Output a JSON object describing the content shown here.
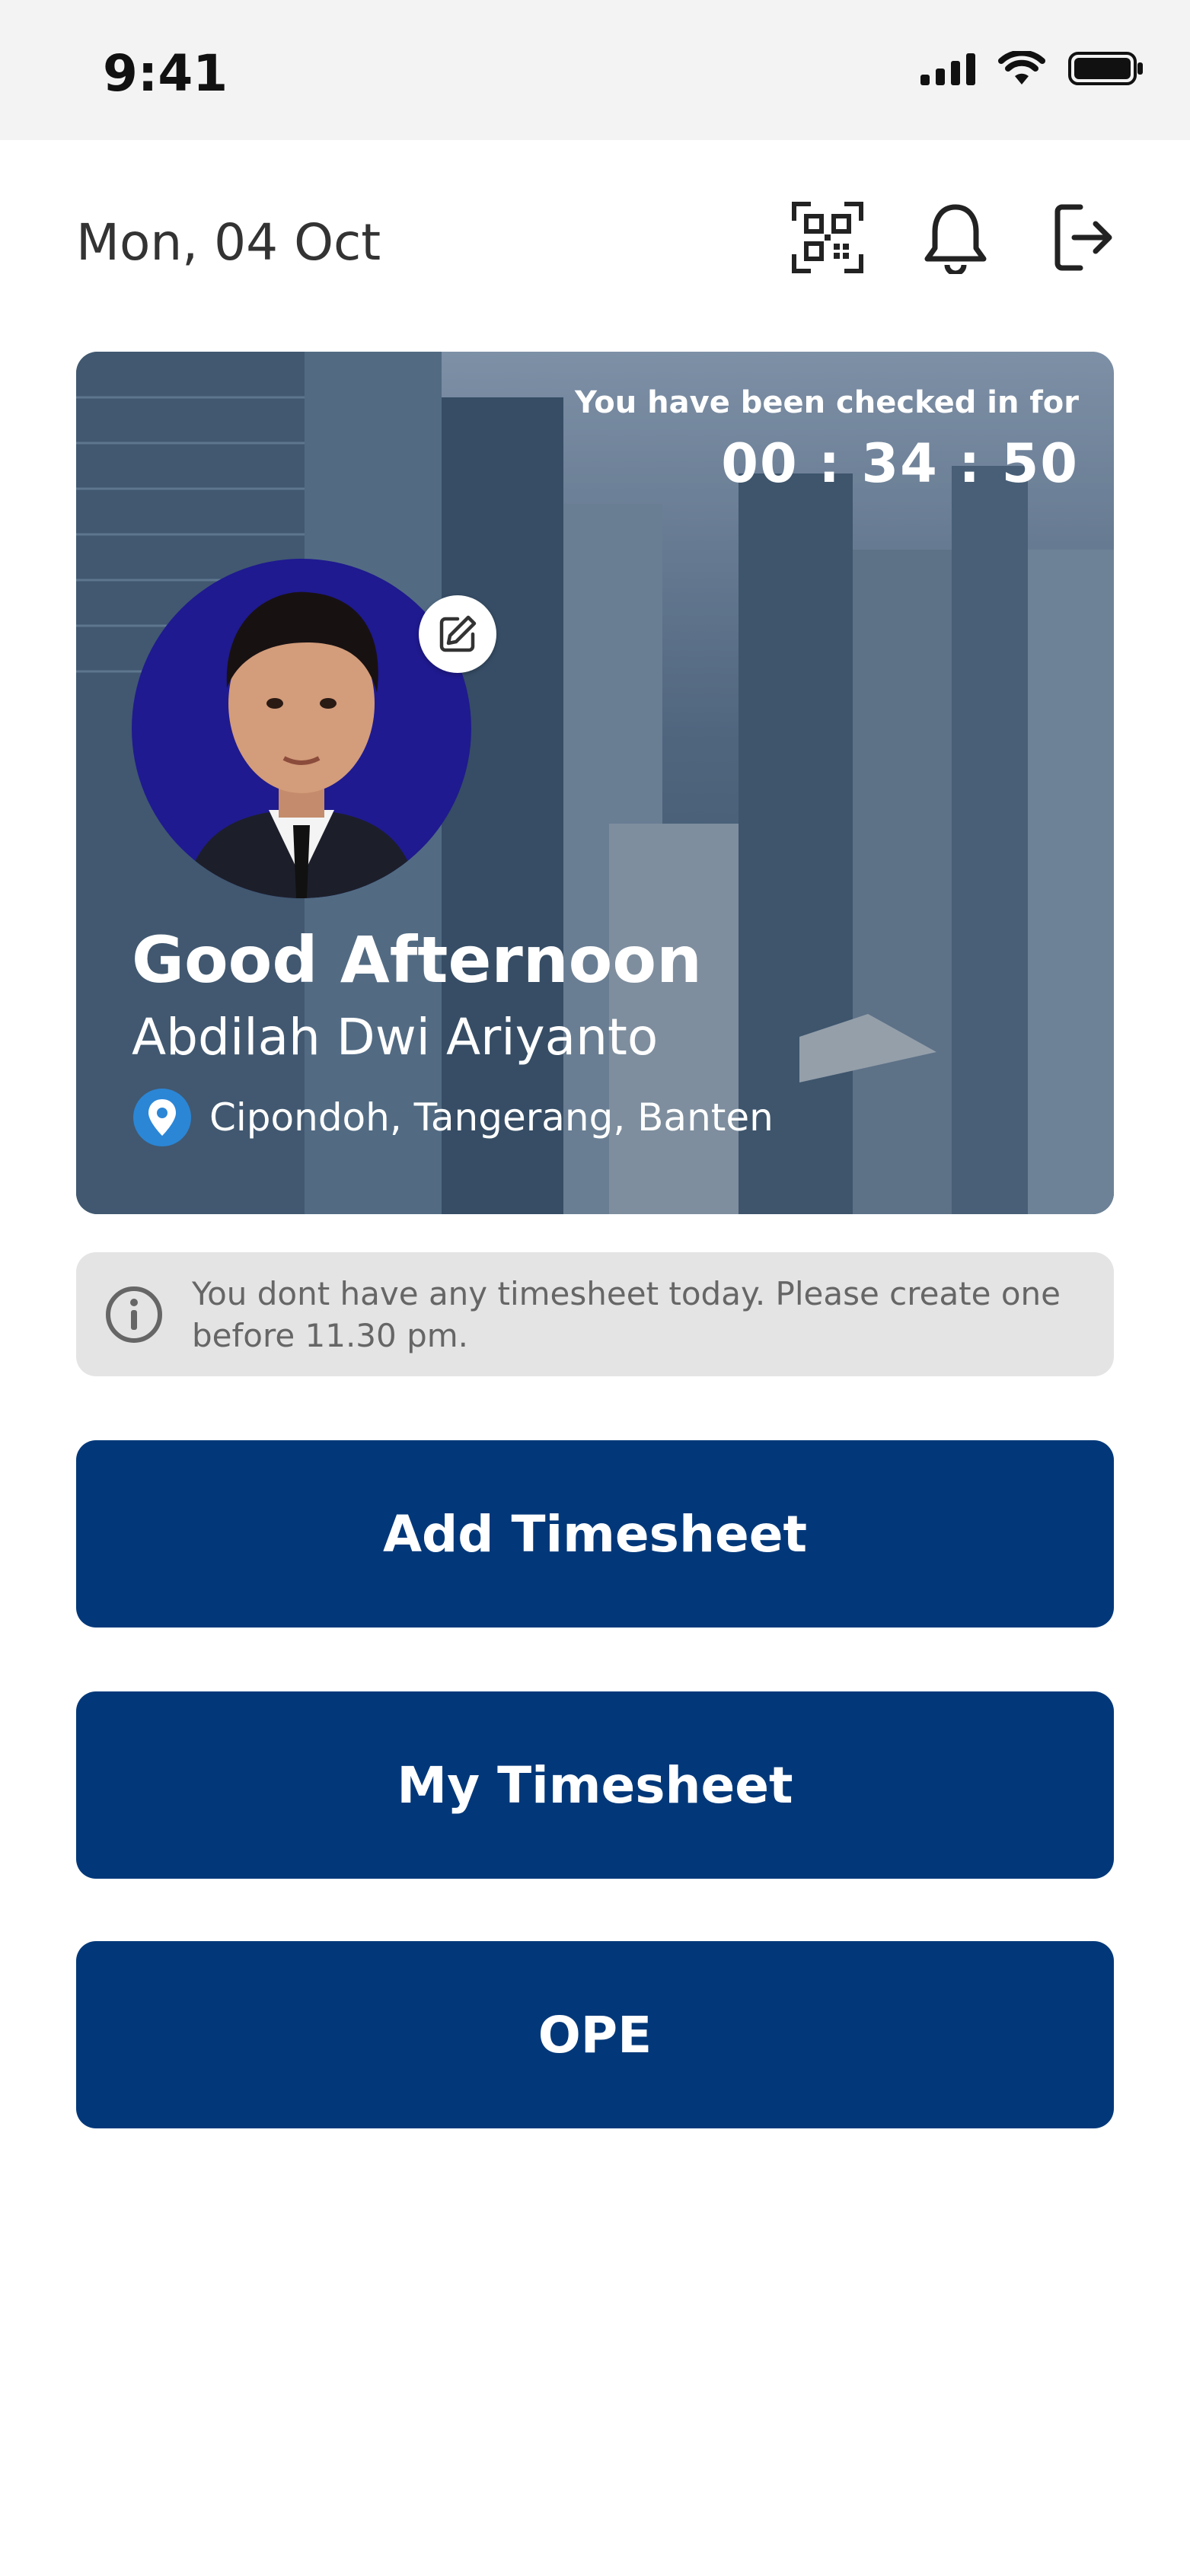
{
  "status_bar": {
    "time": "9:41"
  },
  "header": {
    "date": "Mon, 04 Oct",
    "icons": [
      "qr-scan-icon",
      "bell-icon",
      "logout-icon"
    ]
  },
  "hero": {
    "checkin_label": "You have been checked in for",
    "checkin_timer": "00 : 34 : 50",
    "greeting": "Good Afternoon",
    "user_name": "Abdilah Dwi Ariyanto",
    "location": "Cipondoh, Tangerang, Banten"
  },
  "info": {
    "message": "You dont have any timesheet today. Please create one before 11.30 pm."
  },
  "actions": {
    "add_timesheet": "Add Timesheet",
    "my_timesheet": "My Timesheet",
    "ope": "OPE"
  },
  "colors": {
    "primary": "#02387a",
    "banner_bg": "#e4e4e4",
    "avatar_bg": "#1f1a8f",
    "location_pin": "#2b86d6"
  }
}
